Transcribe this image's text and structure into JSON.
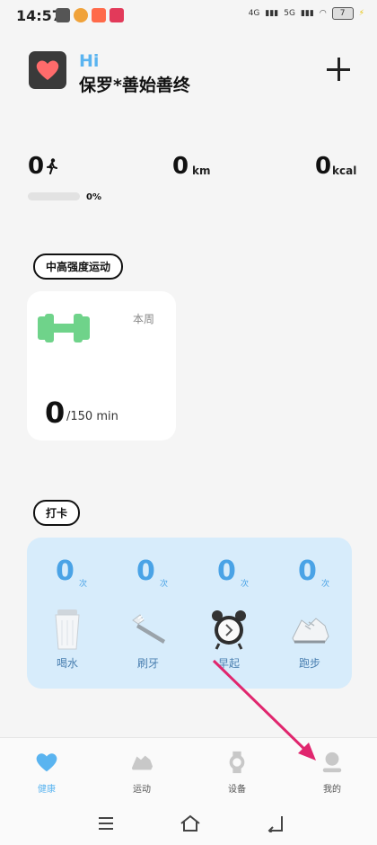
{
  "status_bar": {
    "time": "14:57",
    "network_left": "4G",
    "network_right": "5G",
    "battery": "7"
  },
  "header": {
    "greeting": "Hi",
    "username": "保罗*善始善终"
  },
  "stats": {
    "steps": "0",
    "distance": "0",
    "distance_unit": "km",
    "calories": "0",
    "calories_unit": "kcal",
    "progress_percent": 0,
    "progress_text": "0%"
  },
  "exercise": {
    "section_label": "中高强度运动",
    "period": "本周",
    "value": "0",
    "goal": "/150 min"
  },
  "checkin": {
    "section_label": "打卡",
    "items": [
      {
        "count": "0",
        "unit": "次",
        "label": "喝水",
        "icon": "water-cup-icon"
      },
      {
        "count": "0",
        "unit": "次",
        "label": "刷牙",
        "icon": "toothbrush-icon"
      },
      {
        "count": "0",
        "unit": "次",
        "label": "早起",
        "icon": "alarm-clock-icon"
      },
      {
        "count": "0",
        "unit": "次",
        "label": "跑步",
        "icon": "running-shoe-icon"
      }
    ]
  },
  "bottom_nav": {
    "items": [
      {
        "label": "健康",
        "icon": "heart-icon",
        "active": true
      },
      {
        "label": "运动",
        "icon": "shoe-icon",
        "active": false
      },
      {
        "label": "设备",
        "icon": "watch-icon",
        "active": false
      },
      {
        "label": "我的",
        "icon": "person-icon",
        "active": false
      }
    ]
  },
  "colors": {
    "accent": "#5ab4f0",
    "heart": "#ff6b6b",
    "dumbbell": "#6fd38a",
    "checkin_bg": "#d7ecfb",
    "annotation_arrow": "#e0266e"
  }
}
